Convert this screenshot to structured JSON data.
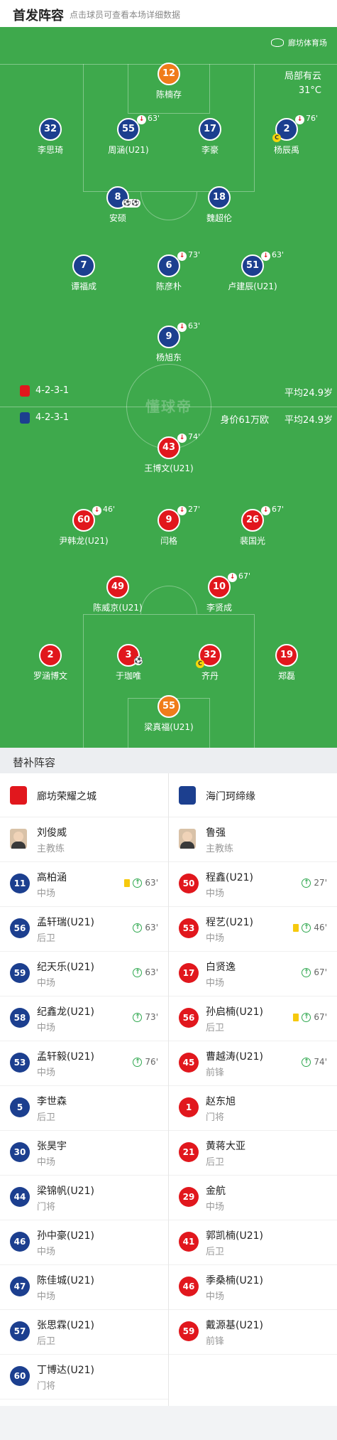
{
  "header": {
    "title": "首发阵容",
    "hint": "点击球员可查看本场详细数据"
  },
  "pitch": {
    "venue": "廊坊体育场",
    "weather": "局部有云",
    "temperature": "31°C",
    "watermark": "懂球帝",
    "home_formation": "4-2-3-1",
    "home_avg_age": "平均24.9岁",
    "away_formation": "4-2-3-1",
    "away_market_value": "身价61万欧",
    "away_avg_age": "平均24.9岁"
  },
  "lineup_home": [
    {
      "num": "12",
      "name": "陈楠存",
      "color": "orange"
    },
    {
      "num": "32",
      "name": "李思琦",
      "color": "blue"
    },
    {
      "num": "55",
      "name": "周涵(U21)",
      "color": "blue",
      "sub": "63'"
    },
    {
      "num": "17",
      "name": "李豪",
      "color": "blue"
    },
    {
      "num": "2",
      "name": "杨辰禹",
      "color": "blue",
      "sub": "76'",
      "captain": "C"
    },
    {
      "num": "8",
      "name": "安硕",
      "color": "blue",
      "ball": "⚽⚽"
    },
    {
      "num": "18",
      "name": "魏超伦",
      "color": "blue"
    },
    {
      "num": "7",
      "name": "谭福成",
      "color": "blue"
    },
    {
      "num": "6",
      "name": "陈彦朴",
      "color": "blue",
      "sub": "73'"
    },
    {
      "num": "51",
      "name": "卢建辰(U21)",
      "color": "blue",
      "sub": "63'"
    },
    {
      "num": "9",
      "name": "杨旭东",
      "color": "blue",
      "sub": "63'"
    }
  ],
  "lineup_away": [
    {
      "num": "43",
      "name": "王博文(U21)",
      "color": "red",
      "sub": "74'"
    },
    {
      "num": "60",
      "name": "尹韩龙(U21)",
      "color": "red",
      "sub": "46'"
    },
    {
      "num": "9",
      "name": "闫格",
      "color": "red",
      "sub": "27'"
    },
    {
      "num": "26",
      "name": "裴国光",
      "color": "red",
      "sub": "67'"
    },
    {
      "num": "49",
      "name": "陈威京(U21)",
      "color": "red"
    },
    {
      "num": "10",
      "name": "李贤成",
      "color": "red",
      "sub": "67'"
    },
    {
      "num": "2",
      "name": "罗涵博文",
      "color": "red"
    },
    {
      "num": "3",
      "name": "于珈唯",
      "color": "red",
      "ball": "⚽"
    },
    {
      "num": "32",
      "name": "齐丹",
      "color": "red",
      "captain": "C"
    },
    {
      "num": "19",
      "name": "郑磊",
      "color": "red"
    },
    {
      "num": "55",
      "name": "梁真福(U21)",
      "color": "orange"
    }
  ],
  "subs": {
    "title": "替补阵容",
    "home_team": "廊坊荣耀之城",
    "away_team": "海门珂缔缘",
    "home_colors": {
      "primary": "#1c3f8f",
      "logo": "#e1171d"
    },
    "away_colors": {
      "primary": "#e1171d",
      "logo": "#1c3f8f"
    },
    "home": [
      {
        "name": "刘俊威",
        "pos": "主教练",
        "coach": true
      },
      {
        "num": "11",
        "name": "高柏涵",
        "pos": "中场",
        "yellow": true,
        "in": "63'"
      },
      {
        "num": "56",
        "name": "孟轩瑞(U21)",
        "pos": "后卫",
        "in": "63'"
      },
      {
        "num": "59",
        "name": "纪天乐(U21)",
        "pos": "中场",
        "in": "63'"
      },
      {
        "num": "58",
        "name": "纪鑫龙(U21)",
        "pos": "中场",
        "in": "73'"
      },
      {
        "num": "53",
        "name": "孟轩毅(U21)",
        "pos": "中场",
        "in": "76'"
      },
      {
        "num": "5",
        "name": "李世森",
        "pos": "后卫"
      },
      {
        "num": "30",
        "name": "张昊宇",
        "pos": "中场"
      },
      {
        "num": "44",
        "name": "梁锦帆(U21)",
        "pos": "门将"
      },
      {
        "num": "46",
        "name": "孙中豪(U21)",
        "pos": "中场"
      },
      {
        "num": "47",
        "name": "陈佳城(U21)",
        "pos": "中场"
      },
      {
        "num": "57",
        "name": "张思霖(U21)",
        "pos": "后卫"
      },
      {
        "num": "60",
        "name": "丁博达(U21)",
        "pos": "门将"
      }
    ],
    "away": [
      {
        "name": "鲁强",
        "pos": "主教练",
        "coach": true
      },
      {
        "num": "50",
        "name": "程鑫(U21)",
        "pos": "中场",
        "in": "27'"
      },
      {
        "num": "53",
        "name": "程艺(U21)",
        "pos": "中场",
        "yellow": true,
        "in": "46'"
      },
      {
        "num": "17",
        "name": "白贤逸",
        "pos": "中场",
        "in": "67'"
      },
      {
        "num": "56",
        "name": "孙启楠(U21)",
        "pos": "后卫",
        "yellow": true,
        "in": "67'"
      },
      {
        "num": "45",
        "name": "曹越涛(U21)",
        "pos": "前锋",
        "in": "74'"
      },
      {
        "num": "1",
        "name": "赵东旭",
        "pos": "门将"
      },
      {
        "num": "21",
        "name": "黄蒋大亚",
        "pos": "后卫"
      },
      {
        "num": "29",
        "name": "金航",
        "pos": "中场"
      },
      {
        "num": "41",
        "name": "郭凯楠(U21)",
        "pos": "后卫"
      },
      {
        "num": "46",
        "name": "季桑楠(U21)",
        "pos": "中场"
      },
      {
        "num": "59",
        "name": "戴源基(U21)",
        "pos": "前锋"
      }
    ]
  }
}
